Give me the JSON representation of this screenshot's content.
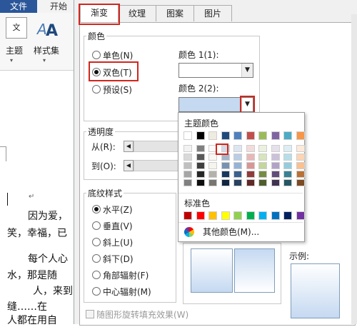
{
  "word": {
    "file_tab": "文件",
    "start_tab": "开始",
    "ribbon": {
      "theme_label": "主题",
      "styles_label": "样式集",
      "theme_icon_text": "文"
    },
    "doc_lines": [
      "因为爱，",
      "笑，幸福，已",
      "每个人心",
      "水，那是随",
      "人，来到",
      "缝……在",
      "人都在用自"
    ]
  },
  "dialog": {
    "tabs": [
      "渐变",
      "纹理",
      "图案",
      "图片"
    ],
    "color_group": {
      "title": "颜色",
      "options": [
        "单色(N)",
        "双色(T)",
        "预设(S)"
      ],
      "color1_label": "颜色 1(1):",
      "color2_label": "颜色 2(2):"
    },
    "transparency": {
      "title": "透明度",
      "from": "从(R):",
      "to": "到(O):"
    },
    "shading": {
      "title": "底纹样式",
      "options": [
        "水平(Z)",
        "垂直(V)",
        "斜上(U)",
        "斜下(D)",
        "角部辐射(F)",
        "中心辐射(M)"
      ]
    },
    "rotate_checkbox": "随图形旋转填充效果(W)",
    "sample_label": "示例:",
    "palette": {
      "theme_title": "主题颜色",
      "standard_title": "标准色",
      "more_colors": "其他颜色(M)...",
      "theme_top": [
        "#ffffff",
        "#000000",
        "#eeece1",
        "#1f497d",
        "#4f81bd",
        "#c0504d",
        "#9bbb59",
        "#8064a2",
        "#4bacc6",
        "#f79646"
      ],
      "standard": [
        "#c00000",
        "#ff0000",
        "#ffc000",
        "#ffff00",
        "#92d050",
        "#00b050",
        "#00b0f0",
        "#0070c0",
        "#002060",
        "#7030a0"
      ]
    },
    "colors": {
      "accent_red": "#d0271e",
      "color2_value": "#c5d9f1"
    }
  }
}
